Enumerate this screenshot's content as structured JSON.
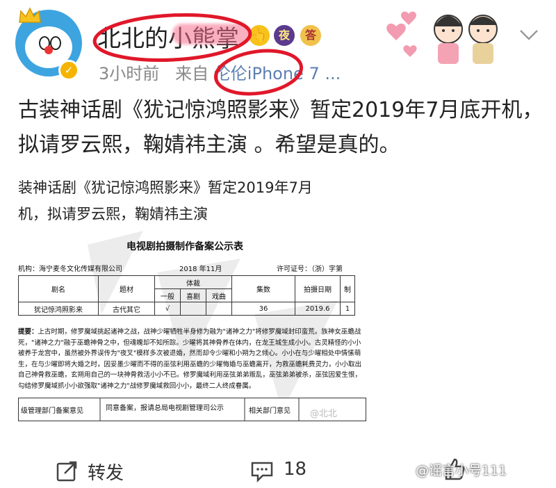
{
  "header": {
    "username": "北北的小熊掌",
    "timestamp": "3小时前",
    "source_prefix": "来自",
    "source": "伦伦iPhone 7 ...",
    "badges": [
      "👆",
      "夜",
      "答"
    ]
  },
  "post": {
    "text": "古装神话剧《犹记惊鸿照影来》暂定2019年7月底开机，拟请罗云熙，鞠婧祎主演 。希望是真的。"
  },
  "image": {
    "line1": "装神话剧《犹记惊鸿照影来》暂定2019年7月",
    "line2": "机，拟请罗云熙，鞠婧祎主演",
    "table_title": "电视剧拍摄制作备案公示表",
    "org": "机构：海宁麦冬文化传媒有限公司",
    "date": "2018 年11月",
    "license": "许可证号：（浙）字第",
    "headers": {
      "name": "剧名",
      "genre": "题材",
      "type": "体裁",
      "type_sub": [
        "一般",
        "喜剧",
        "戏曲"
      ],
      "episodes": "集数",
      "shoot_date": "拍摄日期",
      "extra": "制"
    },
    "row": {
      "name": "犹记惊鸿照影来",
      "genre": "古代其它",
      "general": "√",
      "comedy": "",
      "opera": "",
      "episodes": "36",
      "shoot_date": "2019.6",
      "extra": "1"
    },
    "summary_label": "提要：",
    "summary": "上古时期，修罗魔域挑起诸神之战，战神少曜牺牲半身修为融为\"诸神之力\"将修罗魔域封印蛮荒。族神女巫蟾战死，\"诸神之力\"融于巫蟾神骨之中，但魂魄却不知所踪。少曜将其神骨养在体内，在龙王城生成小小。古灵精怪的小小被养于龙宫中，虽然被外界误传为\"夜叉\"模样多次被退婚，然而却令少曜和小朔为之倾心。小小在与少曜相处中情愫萌生，在与少曜即将大婚之时，因妥墨少曜而不得的巫弦利用巫蟾的少曜悔婚与巫蟾离开，为救巫蟾耗费灵力，小小取出自己神骨救巫蟾，玄朔用自己的一块神骨救活小小不已。修罗魔域利用巫弦弟弟叛乱，巫弦弟弟被杀，巫弦因爱生恨，勾结修罗魔域抓小小欲强取\"诸神之力\"战修罗魔域救回小小，最终二人终成眷属。",
    "bottom_left": "级管理部门备案意见",
    "bottom_mid": "同意备案，报请总局电视剧管理司公示",
    "bottom_right": "相关部门意见",
    "watermark": "@北北"
  },
  "actions": {
    "repost": "转发",
    "comments": "18",
    "like_count": ""
  },
  "watermark": "@谣言小号111"
}
